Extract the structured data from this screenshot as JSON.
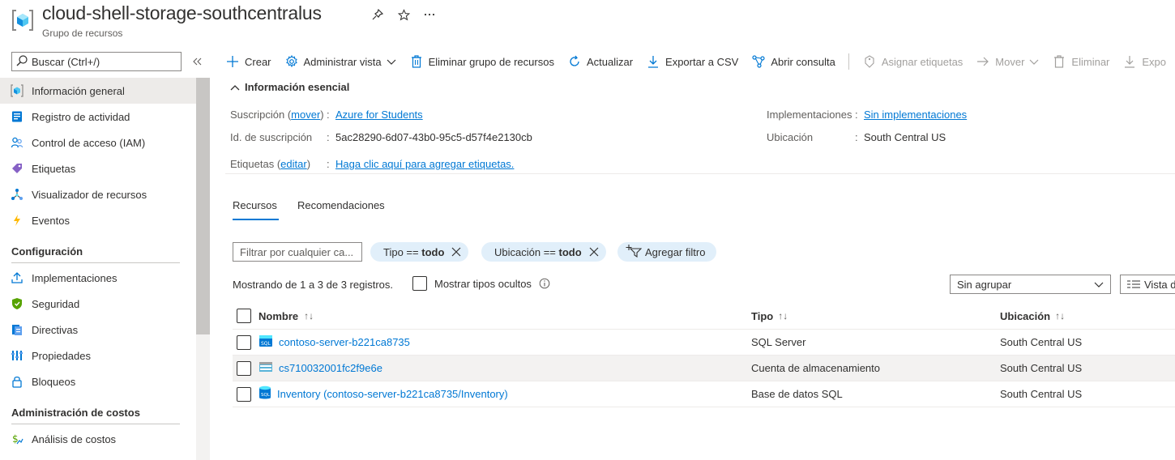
{
  "header": {
    "title": "cloud-shell-storage-southcentralus",
    "subtitle": "Grupo de recursos"
  },
  "sidebar": {
    "search_placeholder": "Buscar (Ctrl+/)",
    "items_top": [
      {
        "label": "Información general",
        "icon": "resource-group-icon"
      },
      {
        "label": "Registro de actividad",
        "icon": "activity-log-icon"
      },
      {
        "label": "Control de acceso (IAM)",
        "icon": "people-icon"
      },
      {
        "label": "Etiquetas",
        "icon": "tag-icon"
      },
      {
        "label": "Visualizador de recursos",
        "icon": "resource-visualizer-icon"
      },
      {
        "label": "Eventos",
        "icon": "lightning-icon"
      }
    ],
    "section_config": "Configuración",
    "items_config": [
      {
        "label": "Implementaciones",
        "icon": "upload-icon"
      },
      {
        "label": "Seguridad",
        "icon": "shield-icon"
      },
      {
        "label": "Directivas",
        "icon": "policy-icon"
      },
      {
        "label": "Propiedades",
        "icon": "properties-icon"
      },
      {
        "label": "Bloqueos",
        "icon": "lock-icon"
      }
    ],
    "section_costs": "Administración de costos",
    "items_costs": [
      {
        "label": "Análisis de costos",
        "icon": "cost-analysis-icon"
      }
    ]
  },
  "toolbar": {
    "create": "Crear",
    "manage_view": "Administrar vista",
    "delete_group": "Eliminar grupo de recursos",
    "refresh": "Actualizar",
    "export_csv": "Exportar a CSV",
    "open_query": "Abrir consulta",
    "assign_tags": "Asignar etiquetas",
    "move": "Mover",
    "delete": "Eliminar",
    "export_partial": "Expo"
  },
  "essentials": {
    "heading": "Información esencial",
    "subscription_label": "Suscripción",
    "subscription_move": "mover",
    "subscription_value": "Azure for Students",
    "subscription_id_label": "Id. de suscripción",
    "subscription_id_value": "5ac28290-6d07-43b0-95c5-d57f4e2130cb",
    "tags_label": "Etiquetas",
    "tags_edit": "editar",
    "tags_value": "Haga clic aquí para agregar etiquetas.",
    "deployments_label": "Implementaciones",
    "deployments_value": "Sin implementaciones",
    "location_label": "Ubicación",
    "location_value": "South Central US"
  },
  "tabs": [
    "Recursos",
    "Recomendaciones"
  ],
  "filters": {
    "placeholder": "Filtrar por cualquier ca...",
    "pill_type_label": "Tipo ==",
    "pill_type_value": "todo",
    "pill_loc_label": "Ubicación ==",
    "pill_loc_value": "todo",
    "add_filter": "Agregar filtro"
  },
  "records_text": "Mostrando de 1 a 3 de 3 registros.",
  "show_hidden": "Mostrar tipos ocultos",
  "grouping": "Sin agrupar",
  "view_partial": "Vista d",
  "table": {
    "columns": [
      "Nombre",
      "Tipo",
      "Ubicación"
    ],
    "rows": [
      {
        "name": "contoso-server-b221ca8735",
        "type": "SQL Server",
        "location": "South Central US",
        "icon": "sql-server-icon"
      },
      {
        "name": "cs710032001fc2f9e6e",
        "type": "Cuenta de almacenamiento",
        "location": "South Central US",
        "icon": "storage-account-icon"
      },
      {
        "name": "Inventory (contoso-server-b221ca8735/Inventory)",
        "type": "Base de datos SQL",
        "location": "South Central US",
        "icon": "sql-database-icon"
      }
    ]
  }
}
